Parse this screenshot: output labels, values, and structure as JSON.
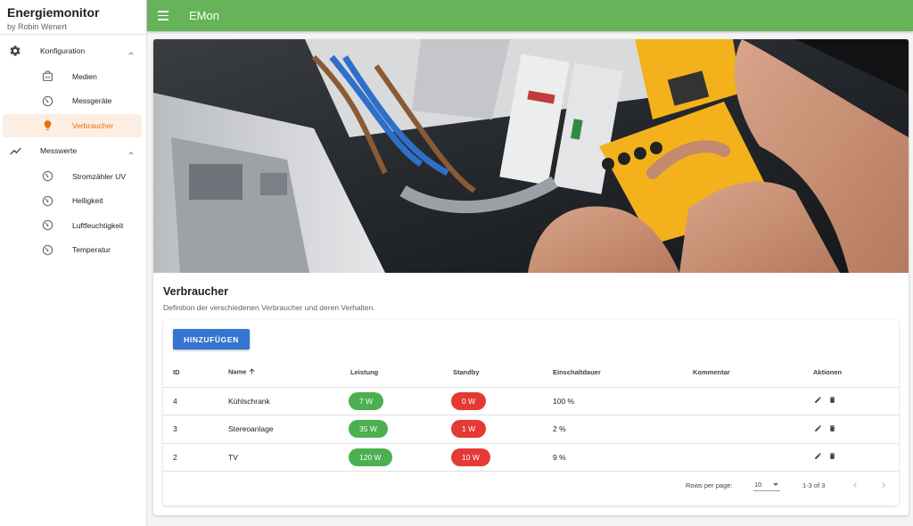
{
  "sidebar": {
    "title": "Energiemonitor",
    "subtitle": "by Robin Wenert",
    "groups": [
      {
        "label": "Konfiguration",
        "icon": "gear-icon",
        "items": [
          {
            "label": "Medien",
            "icon": "meter-icon"
          },
          {
            "label": "Messgeräte",
            "icon": "gauge-icon"
          },
          {
            "label": "Verbraucher",
            "icon": "lightbulb-icon",
            "active": true
          }
        ]
      },
      {
        "label": "Messwerte",
        "icon": "trend-icon",
        "items": [
          {
            "label": "Stromzähler UV",
            "icon": "gauge-icon"
          },
          {
            "label": "Helligkeit",
            "icon": "gauge-icon"
          },
          {
            "label": "Luftfeuchtigkeit",
            "icon": "gauge-icon"
          },
          {
            "label": "Temperatur",
            "icon": "gauge-icon"
          }
        ]
      }
    ]
  },
  "appbar": {
    "title": "EMon",
    "color": "#66b35a"
  },
  "page": {
    "title": "Verbraucher",
    "subtitle": "Definition der verschiedenen Verbraucher und deren Verhalten.",
    "add_label": "HINZUFÜGEN"
  },
  "table": {
    "headers": {
      "id": "ID",
      "name": "Name",
      "leistung": "Leistung",
      "standby": "Standby",
      "einschaltdauer": "Einschaltdauer",
      "kommentar": "Kommentar",
      "aktionen": "Aktionen"
    },
    "rows": [
      {
        "id": "4",
        "name": "Kühlschrank",
        "leistung": "7 W",
        "standby": "0 W",
        "einschaltdauer": "100 %",
        "kommentar": ""
      },
      {
        "id": "3",
        "name": "Stereoanlage",
        "leistung": "35 W",
        "standby": "1 W",
        "einschaltdauer": "2 %",
        "kommentar": ""
      },
      {
        "id": "2",
        "name": "TV",
        "leistung": "120 W",
        "standby": "10 W",
        "einschaltdauer": "9 %",
        "kommentar": ""
      }
    ],
    "footer": {
      "rows_per_page_label": "Rows per page:",
      "rows_per_page_value": "10",
      "range": "1-3 of 3"
    }
  },
  "colors": {
    "accent": "#ef6c00",
    "primary_button": "#3574d1",
    "chip_green": "#4caf50",
    "chip_red": "#e53935"
  }
}
